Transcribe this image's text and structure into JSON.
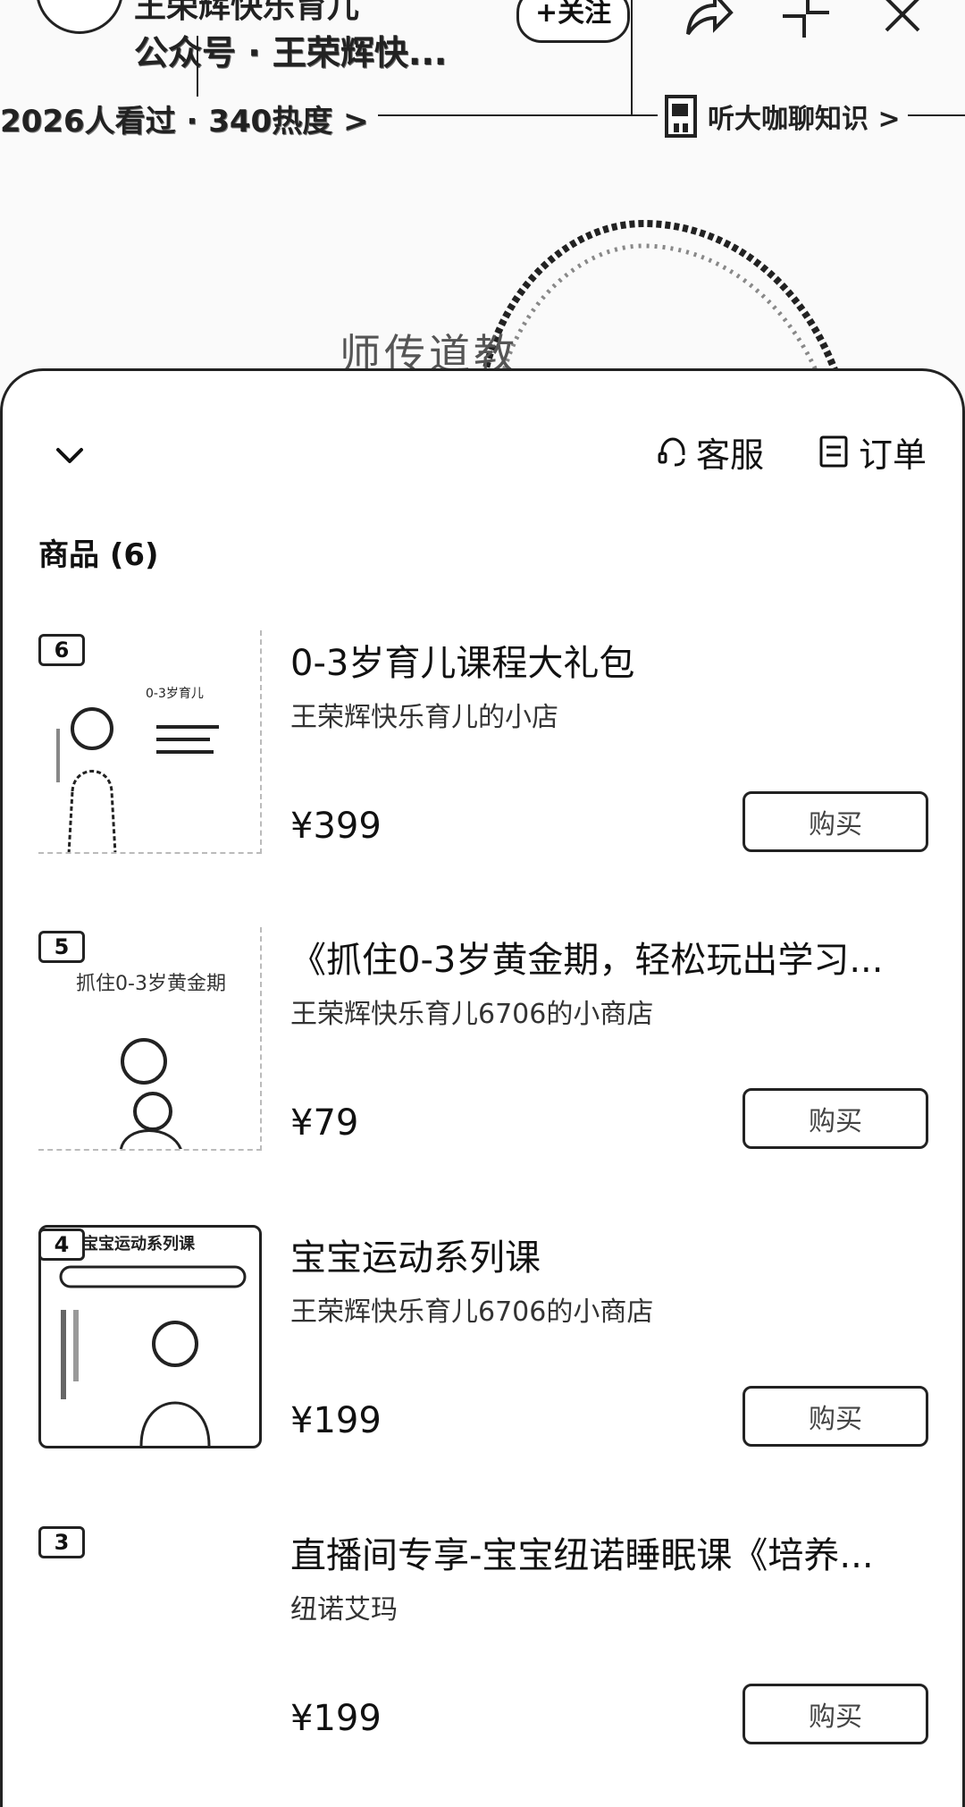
{
  "header": {
    "account_line": "王荣辉快乐育儿",
    "account_source": "公众号 · 王荣辉快...",
    "follow_label": "+关注",
    "view_stats": "2026人看过 · 340热度 >",
    "listen_link": "听大咖聊知识 >",
    "overlay_text": "师传道教"
  },
  "sheet": {
    "service_label": "客服",
    "orders_label": "订单",
    "section_title": "商品 (6)",
    "products": [
      {
        "rank": "6",
        "title": "0-3岁育儿课程大礼包",
        "shop": "王荣辉快乐育儿的小店",
        "price": "¥399",
        "buy_label": "购买",
        "thumb_caption": "0-3岁育儿"
      },
      {
        "rank": "5",
        "title": "《抓住0-3岁黄金期，轻松玩出学习...",
        "shop": "王荣辉快乐育儿6706的小商店",
        "price": "¥79",
        "buy_label": "购买",
        "thumb_caption": "抓住0-3岁黄金期"
      },
      {
        "rank": "4",
        "title": "宝宝运动系列课",
        "shop": "王荣辉快乐育儿6706的小商店",
        "price": "¥199",
        "buy_label": "购买",
        "thumb_caption": "宝宝运动系列课"
      },
      {
        "rank": "3",
        "title": "直播间专享-宝宝纽诺睡眠课《培养...",
        "shop": "纽诺艾玛",
        "price": "¥199",
        "buy_label": "购买"
      }
    ]
  },
  "colors": {
    "ink": "#111111",
    "border": "#222222",
    "muted": "#444444",
    "background": "#ffffff"
  }
}
